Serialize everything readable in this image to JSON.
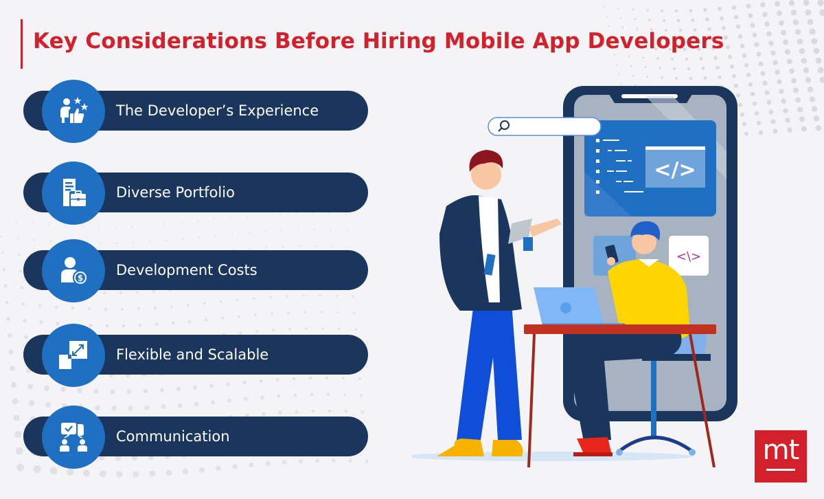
{
  "header": {
    "title": "Key Considerations Before Hiring Mobile App Developers"
  },
  "considerations": [
    {
      "label": "The Developer’s Experience",
      "icon": "user-rating-stars-icon"
    },
    {
      "label": "Diverse Portfolio",
      "icon": "portfolio-briefcase-icon"
    },
    {
      "label": "Development Costs",
      "icon": "user-dollar-icon"
    },
    {
      "label": "Flexible and Scalable",
      "icon": "resize-scale-icon"
    },
    {
      "label": "Communication",
      "icon": "people-chat-icon"
    }
  ],
  "illustration": {
    "search_placeholder": "",
    "code_symbol_large": "</>",
    "code_symbol_small": "<\\>"
  },
  "brand": {
    "logo_text": "mt"
  },
  "colors": {
    "accent_red": "#d3212c",
    "pill_navy": "#1b365d",
    "icon_blue": "#1f6fc2",
    "background": "#f4f4f7"
  }
}
